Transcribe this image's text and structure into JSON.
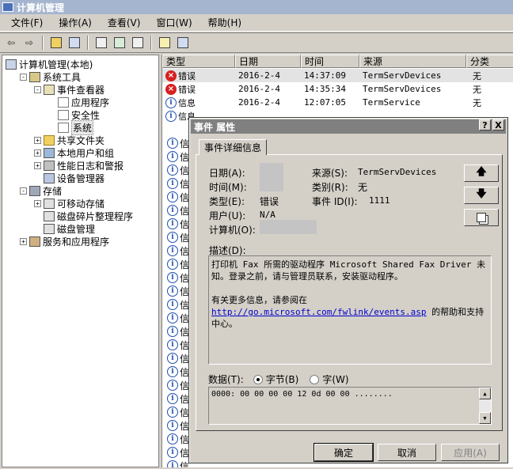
{
  "window": {
    "title": "计算机管理"
  },
  "menu": [
    "文件(F)",
    "操作(A)",
    "查看(V)",
    "窗口(W)",
    "帮助(H)"
  ],
  "tree": [
    {
      "label": "计算机管理(本地)",
      "level": 0,
      "exp": "",
      "icon": "pc"
    },
    {
      "label": "系统工具",
      "level": 1,
      "exp": "-",
      "icon": "tool"
    },
    {
      "label": "事件查看器",
      "level": 2,
      "exp": "-",
      "icon": "ev"
    },
    {
      "label": "应用程序",
      "level": 3,
      "exp": "",
      "icon": "log"
    },
    {
      "label": "安全性",
      "level": 3,
      "exp": "",
      "icon": "log"
    },
    {
      "label": "系统",
      "level": 3,
      "exp": "",
      "icon": "log",
      "selected": true
    },
    {
      "label": "共享文件夹",
      "level": 2,
      "exp": "+",
      "icon": "folder"
    },
    {
      "label": "本地用户和组",
      "level": 2,
      "exp": "+",
      "icon": "users"
    },
    {
      "label": "性能日志和警报",
      "level": 2,
      "exp": "+",
      "icon": "perf"
    },
    {
      "label": "设备管理器",
      "level": 2,
      "exp": "",
      "icon": "dev"
    },
    {
      "label": "存储",
      "level": 1,
      "exp": "-",
      "icon": "store"
    },
    {
      "label": "可移动存储",
      "level": 2,
      "exp": "+",
      "icon": "disk"
    },
    {
      "label": "磁盘碎片整理程序",
      "level": 2,
      "exp": "",
      "icon": "disk"
    },
    {
      "label": "磁盘管理",
      "level": 2,
      "exp": "",
      "icon": "disk"
    },
    {
      "label": "服务和应用程序",
      "level": 1,
      "exp": "+",
      "icon": "svc"
    }
  ],
  "list": {
    "headers": [
      "类型",
      "日期",
      "时间",
      "来源",
      "分类"
    ],
    "rows": [
      {
        "type": "错误",
        "icon": "error",
        "date": "2016-2-4",
        "time": "14:37:09",
        "source": "TermServDevices",
        "category": "无",
        "selected": true
      },
      {
        "type": "错误",
        "icon": "error",
        "date": "2016-2-4",
        "time": "14:35:34",
        "source": "TermServDevices",
        "category": "无"
      },
      {
        "type": "信息",
        "icon": "info",
        "date": "2016-2-4",
        "time": "12:07:05",
        "source": "TermService",
        "category": "无"
      },
      {
        "type": "信息",
        "icon": "info",
        "date": "",
        "time": "",
        "source": "",
        "category": ""
      }
    ],
    "partial_label": "信"
  },
  "dialog": {
    "title": "事件 属性",
    "help_btn": "?",
    "close_btn": "X",
    "tab": "事件详细信息",
    "date_label": "日期(A):",
    "time_label": "时间(M):",
    "type_label": "类型(E):",
    "type_value": "错误",
    "user_label": "用户(U):",
    "user_value": "N/A",
    "computer_label": "计算机(O):",
    "source_label": "来源(S):",
    "source_value": "TermServDevices",
    "category_label": "类别(R):",
    "category_value": "无",
    "eventid_label": "事件 ID(I):",
    "eventid_value": "1111",
    "desc_label": "描述(D):",
    "desc_line1": "打印机 Fax 所需的驱动程序 Microsoft Shared Fax Driver 未知。登录之前，请与管理员联系，安装驱动程序。",
    "desc_line2": "有关更多信息，请参阅在",
    "desc_link": "http://go.microsoft.com/fwlink/events.asp",
    "desc_line3": "的帮助和支持中心。",
    "data_label": "数据(T):",
    "radio_bytes": "字节(B)",
    "radio_words": "字(W)",
    "data_value": "0000: 00 00 00 00 12 0d 00 00   ........",
    "ok": "确定",
    "cancel": "取消",
    "apply": "应用(A)"
  }
}
